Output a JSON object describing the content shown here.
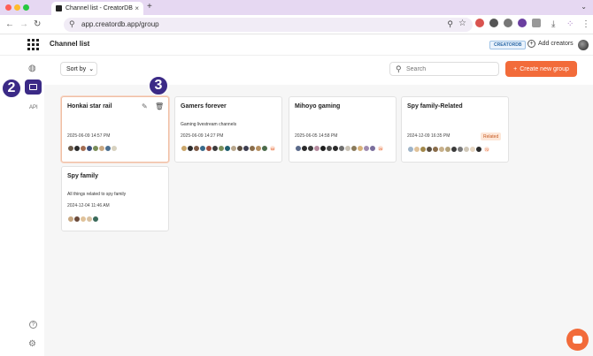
{
  "browser": {
    "tab_title": "Channel list - CreatorDB",
    "url": "app.creatordb.app/group",
    "traffic_colors": [
      "#ff5f57",
      "#febc2e",
      "#28c840"
    ]
  },
  "header": {
    "page_title": "Channel list",
    "badge": "CREATORDB",
    "add_creators": "Add creators"
  },
  "sidebar": {
    "api_label": "API"
  },
  "steps": {
    "step2": "2",
    "step3": "3"
  },
  "toolbar": {
    "sort_label": "Sort by",
    "search_placeholder": "Search",
    "create_label": "Create new group"
  },
  "accent_color": "#f26b3a",
  "groups": [
    {
      "name": "Honkai star rail",
      "description": "",
      "date": "2025-06-09 14:57 PM",
      "avatar_colors": [
        "#6b5b4a",
        "#2b2b2b",
        "#a36d52",
        "#3b4e7a",
        "#7a8d59",
        "#c8a882",
        "#4c6f8f",
        "#d8d2c0"
      ],
      "more": "",
      "tag": ""
    },
    {
      "name": "Gamers forever",
      "description": "Gaming livestream channels",
      "date": "2025-06-09 14:27 PM",
      "avatar_colors": [
        "#caa66a",
        "#2b2b2b",
        "#7e5a46",
        "#3a6a8a",
        "#9e4c3c",
        "#3b3b3b",
        "#7b8f5a",
        "#1f5f6f",
        "#b9a78c",
        "#5c4e3f",
        "#3d3d50",
        "#8a6d4b",
        "#b58f60",
        "#4b6b4b"
      ],
      "more": "68",
      "tag": ""
    },
    {
      "name": "Mihoyo gaming",
      "description": "",
      "date": "2025-06-05 14:58 PM",
      "avatar_colors": [
        "#5a6a8a",
        "#2b2b2b",
        "#3a3a3a",
        "#b58a9e",
        "#1e1e1e",
        "#4a4a4a",
        "#2a2a2a",
        "#6e6e6e",
        "#c9c2b5",
        "#8a7a5a",
        "#d8b27a",
        "#a08cb0",
        "#7a6e9c"
      ],
      "more": "26",
      "tag": ""
    },
    {
      "name": "Spy family-Related",
      "description": "",
      "date": "2024-12-09 16:35 PM",
      "tag": "Related",
      "avatar_colors": [
        "#9fb4c8",
        "#e0c29a",
        "#a3894b",
        "#5a4e3f",
        "#8a6d4b",
        "#c8b08a",
        "#b3a27a",
        "#3b3b3b",
        "#7a7a7a",
        "#d0c8b8",
        "#e6d6c2",
        "#2b2b2b"
      ],
      "more": "72"
    },
    {
      "name": "Spy family",
      "description": "All things related to spy family",
      "date": "2024-12-04 11:46 AM",
      "avatar_colors": [
        "#c8a882",
        "#6b4a3a",
        "#e0c29a",
        "#d8c0a0",
        "#3a6a5a"
      ],
      "more": "",
      "tag": ""
    }
  ]
}
